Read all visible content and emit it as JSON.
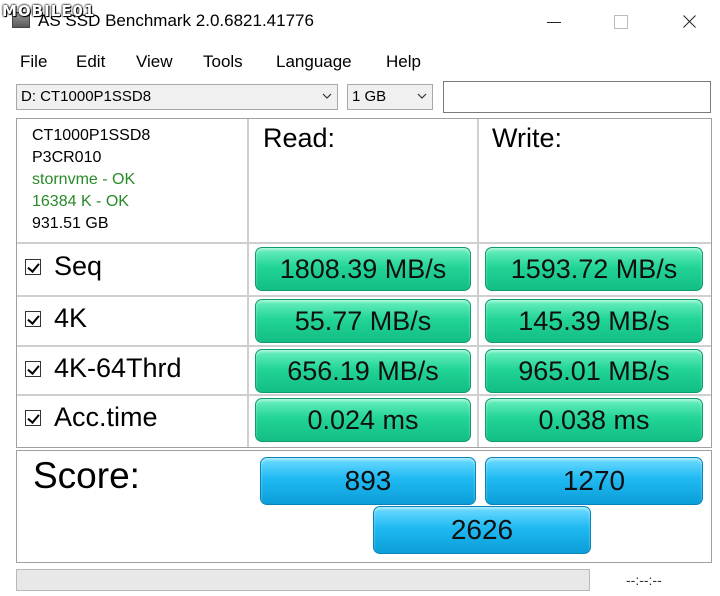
{
  "watermark": "MOBILE01",
  "window": {
    "title": "AS SSD Benchmark 2.0.6821.41776"
  },
  "menu": [
    "File",
    "Edit",
    "View",
    "Tools",
    "Language",
    "Help"
  ],
  "toolbar": {
    "drive": "D: CT1000P1SSD8",
    "size": "1 GB",
    "text_value": ""
  },
  "drive_info": {
    "model": "CT1000P1SSD8",
    "firmware": "P3CR010",
    "driver": "stornvme - OK",
    "alignment": "16384 K - OK",
    "capacity": "931.51 GB"
  },
  "columns": {
    "read": "Read:",
    "write": "Write:"
  },
  "tests": [
    {
      "label": "Seq",
      "checked": true,
      "read": "1808.39 MB/s",
      "write": "1593.72 MB/s"
    },
    {
      "label": "4K",
      "checked": true,
      "read": "55.77 MB/s",
      "write": "145.39 MB/s"
    },
    {
      "label": "4K-64Thrd",
      "checked": true,
      "read": "656.19 MB/s",
      "write": "965.01 MB/s"
    },
    {
      "label": "Acc.time",
      "checked": true,
      "read": "0.024 ms",
      "write": "0.038 ms"
    }
  ],
  "score": {
    "label": "Score:",
    "read": "893",
    "write": "1270",
    "total": "2626"
  },
  "status": {
    "progress": 0,
    "time": "--:--:--"
  },
  "colors": {
    "result_green": "#23d597",
    "score_blue": "#1fb9f2",
    "ok_text": "#2a8a2a"
  }
}
